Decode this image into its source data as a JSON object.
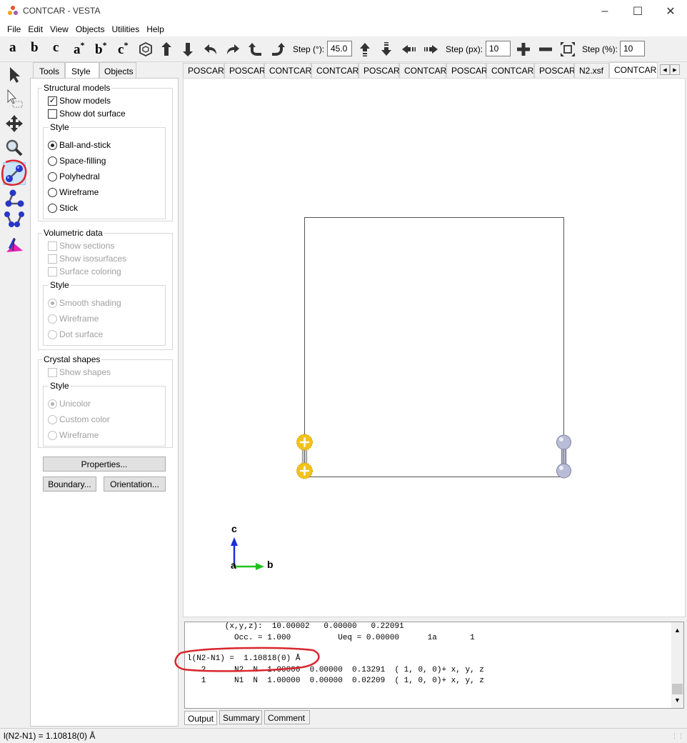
{
  "window": {
    "title": "CONTCAR - VESTA"
  },
  "menu": [
    "File",
    "Edit",
    "View",
    "Objects",
    "Utilities",
    "Help"
  ],
  "toolbar": {
    "axis_buttons": [
      "a",
      "b",
      "c",
      "a",
      "b",
      "c"
    ],
    "axis_star": "*",
    "step_deg_label": "Step (°):",
    "step_deg_value": "45.0",
    "step_px_label": "Step (px):",
    "step_px_value": "10",
    "step_pct_label": "Step (%):",
    "step_pct_value": "10"
  },
  "panel": {
    "tabs": [
      "Tools",
      "Style",
      "Objects"
    ],
    "active_tab": "Style",
    "structural": {
      "title": "Structural models",
      "show_models": "Show models",
      "show_dot_surface": "Show dot surface",
      "style_title": "Style",
      "options": [
        "Ball-and-stick",
        "Space-filling",
        "Polyhedral",
        "Wireframe",
        "Stick"
      ],
      "selected": "Ball-and-stick"
    },
    "volumetric": {
      "title": "Volumetric data",
      "show_sections": "Show sections",
      "show_isosurfaces": "Show isosurfaces",
      "surface_coloring": "Surface coloring",
      "style_title": "Style",
      "options": [
        "Smooth shading",
        "Wireframe",
        "Dot surface"
      ]
    },
    "crystal": {
      "title": "Crystal shapes",
      "show_shapes": "Show shapes",
      "style_title": "Style",
      "options": [
        "Unicolor",
        "Custom color",
        "Wireframe"
      ]
    },
    "buttons": {
      "properties": "Properties...",
      "boundary": "Boundary...",
      "orientation": "Orientation..."
    }
  },
  "file_tabs": [
    "POSCAR",
    "POSCAR",
    "CONTCAR",
    "CONTCAR",
    "POSCAR",
    "CONTCAR",
    "POSCAR",
    "CONTCAR",
    "POSCAR",
    "N2.xsf",
    "CONTCAR"
  ],
  "active_file_tab": "CONTCAR",
  "axes": {
    "vertical": "c",
    "horizontal": "b",
    "origin": "a"
  },
  "output": {
    "lines": [
      "        (x,y,z):  10.00002   0.00000   0.22091",
      "          Occ. = 1.000          Ueq = 0.00000      1a       1",
      "",
      "l(N2-N1) =  1.10818(0) Å",
      "   2      N2  N  1.00000  0.00000  0.13291  ( 1, 0, 0)+ x, y, z",
      "   1      N1  N  1.00000  0.00000  0.02209  ( 1, 0, 0)+ x, y, z"
    ],
    "tabs": [
      "Output",
      "Summary",
      "Comment"
    ]
  },
  "status": "l(N2-N1) = 1.10818(0) Å",
  "colors": {
    "annotation": "#d9262c",
    "atom_selected": "#f2c21b",
    "atom": "#b8bcd6",
    "axis_c": "#1a2fd6",
    "axis_b": "#1fc21f"
  }
}
